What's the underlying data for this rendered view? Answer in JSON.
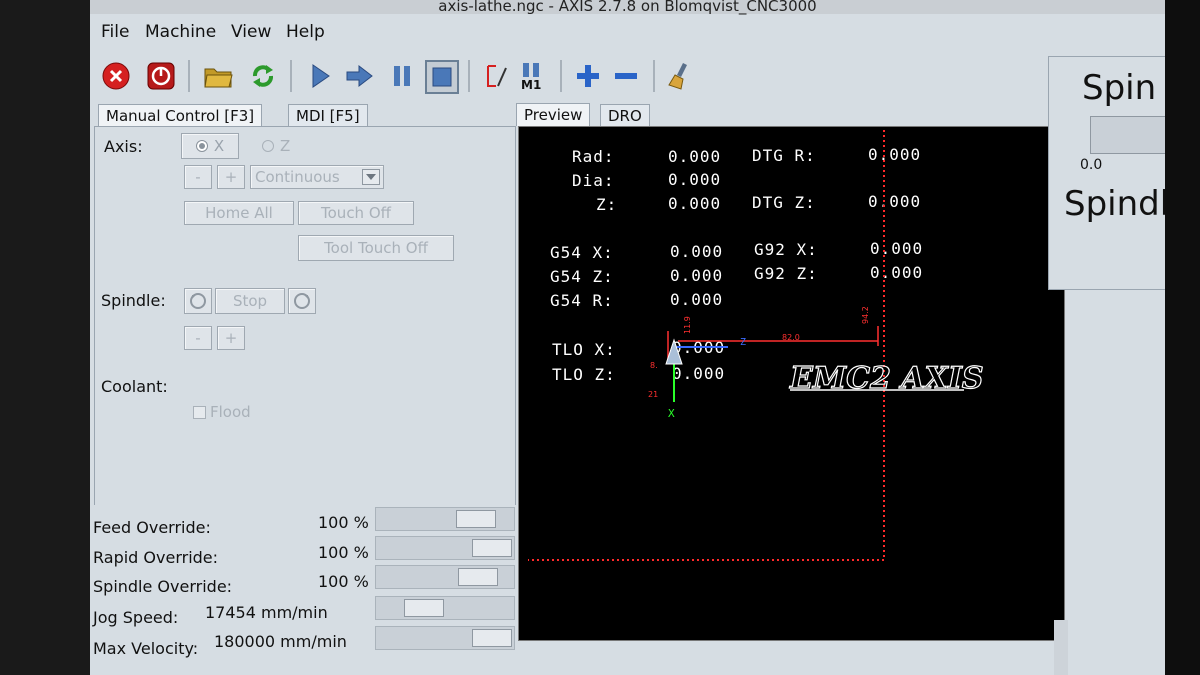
{
  "window": {
    "title": "axis-lathe.ngc - AXIS 2.7.8 on Blomqvist_CNC3000"
  },
  "menu": [
    "File",
    "Machine",
    "View",
    "Help"
  ],
  "toolbar": {
    "icons": [
      "estop-icon",
      "power-icon",
      "open-file-icon",
      "reload-icon",
      "run-icon",
      "step-icon",
      "pause-icon",
      "stop-icon",
      "block-delete-icon",
      "optional-stop-icon",
      "zoom-in-icon",
      "zoom-out-icon",
      "clear-plot-icon"
    ],
    "m1_label": "M1"
  },
  "left_tabs": [
    "Manual Control [F3]",
    "MDI [F5]"
  ],
  "manual": {
    "axis_label": "Axis:",
    "axis_x": "X",
    "axis_z": "Z",
    "minus": "-",
    "plus": "+",
    "jog_mode": "Continuous",
    "home_all": "Home All",
    "touch_off": "Touch Off",
    "tool_touch_off": "Tool Touch Off",
    "spindle_label": "Spindle:",
    "stop": "Stop",
    "coolant_label": "Coolant:",
    "flood": "Flood"
  },
  "overrides": {
    "feed_label": "Feed Override:",
    "feed_value": "100 %",
    "rapid_label": "Rapid Override:",
    "rapid_value": "100 %",
    "spindle_label": "Spindle Override:",
    "spindle_value": "100 %",
    "jog_label": "Jog Speed:",
    "jog_value": "17454 mm/min",
    "maxvel_label": "Max Velocity:",
    "maxvel_value": "180000 mm/min"
  },
  "right_tabs": [
    "Preview",
    "DRO"
  ],
  "dro": {
    "rad_label": "Rad:",
    "rad_value": "0.000",
    "dia_label": "Dia:",
    "dia_value": "0.000",
    "z_label": "Z:",
    "z_value": "0.000",
    "dtg_r_label": "DTG R:",
    "dtg_r_value": "0.000",
    "dtg_z_label": "DTG Z:",
    "dtg_z_value": "0.000",
    "g54x_label": "G54 X:",
    "g54x_value": "0.000",
    "g54z_label": "G54 Z:",
    "g54z_value": "0.000",
    "g54r_label": "G54 R:",
    "g54r_value": "0.000",
    "g92x_label": "G92 X:",
    "g92x_value": "0.000",
    "g92z_label": "G92 Z:",
    "g92z_value": "0.000",
    "tlox_label": "TLO X:",
    "tlox_value": "0.000",
    "tloz_label": "TLO Z:",
    "tloz_value": "0.000"
  },
  "preview": {
    "dim_top": "82.0",
    "dim_right": "94.2",
    "dim_left_top": "11.9",
    "dim_left_a": "8.",
    "dim_left_b": "21",
    "origin_z": "Z",
    "origin_x": "X",
    "program_text": "EMC2 AXIS"
  },
  "right_panel": {
    "spindle_title": "Spin",
    "spindle_value": "0.0",
    "spindle_label2": "Spindl"
  },
  "colors": {
    "window_bg": "#d6dde3",
    "preview_bg": "#000000",
    "limit_red": "#ff2a2a",
    "axis_green": "#2aff2a",
    "axis_blue": "#3a6bff"
  }
}
